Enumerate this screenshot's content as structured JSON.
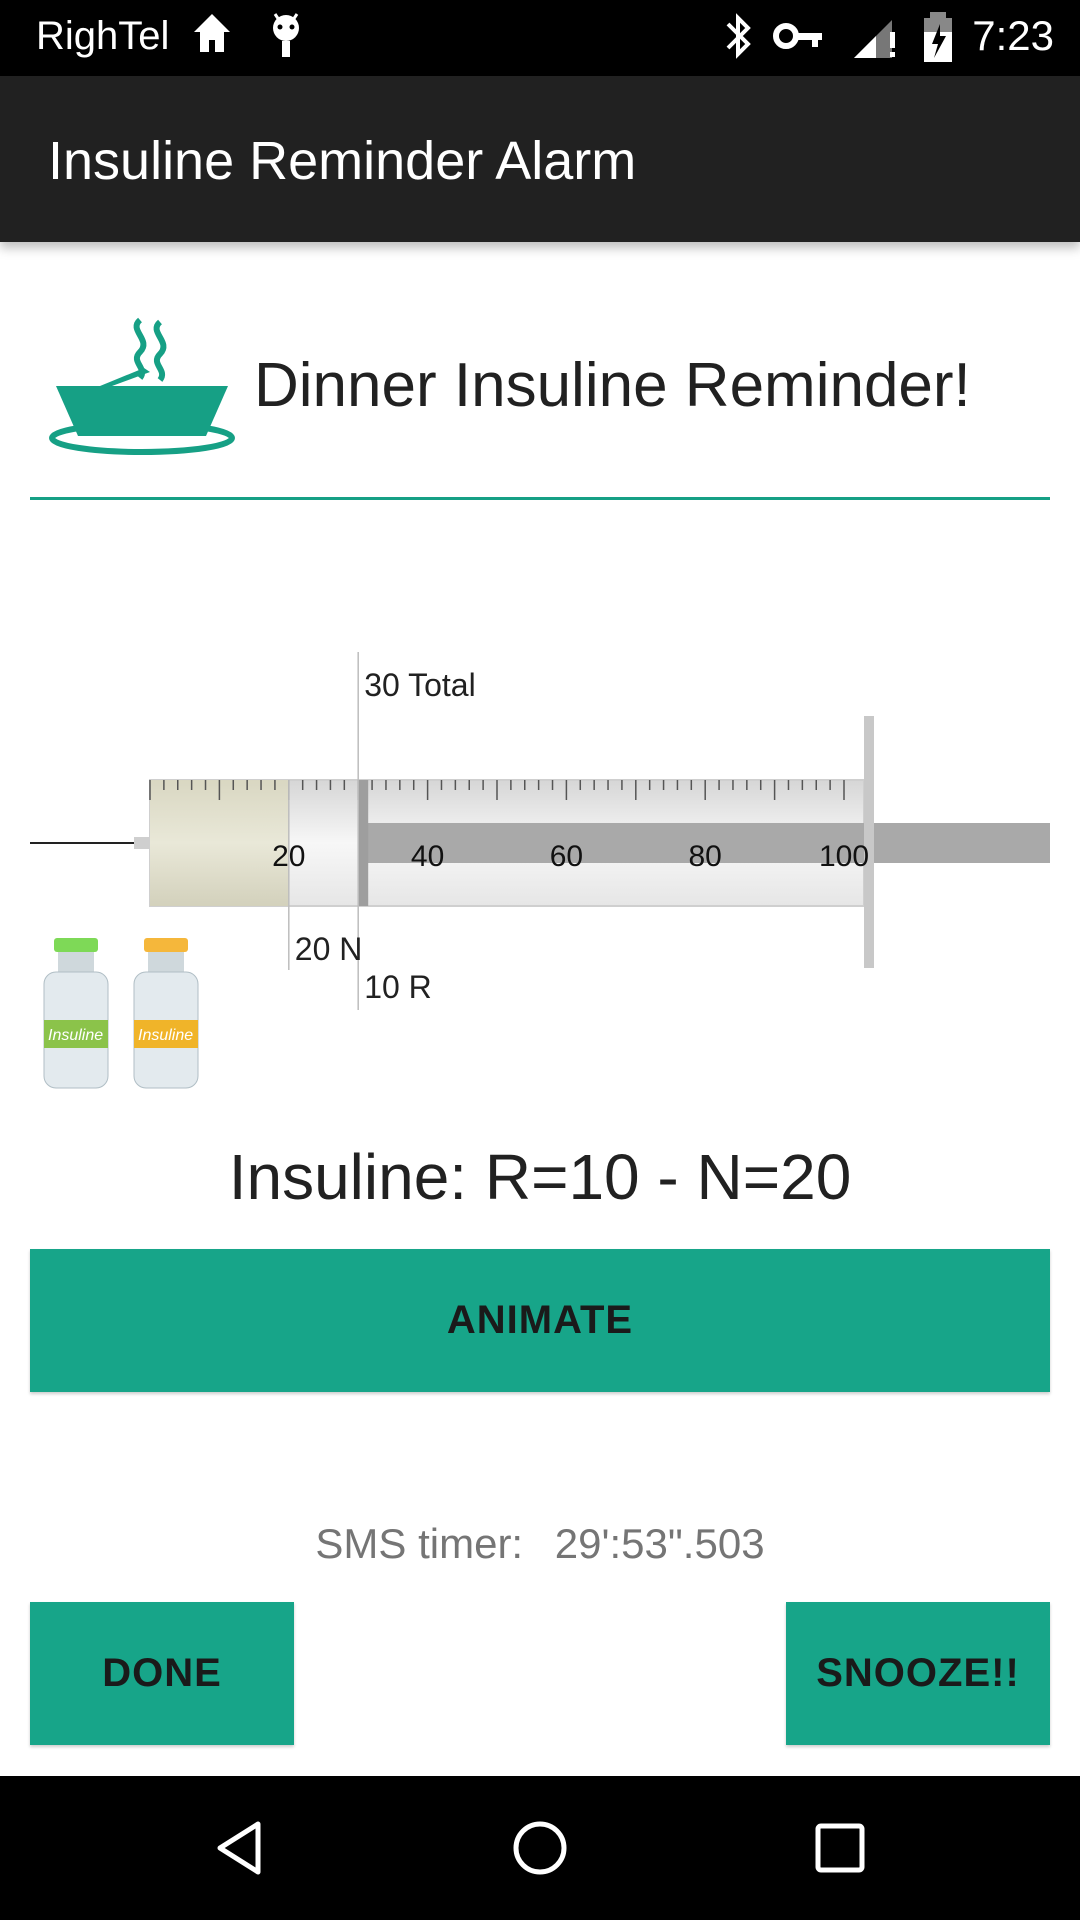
{
  "status_bar": {
    "carrier": "RighTel",
    "time": "7:23",
    "icons": [
      "home-icon",
      "android-icon",
      "bluetooth-icon",
      "vpn-key-icon",
      "signal-icon",
      "battery-icon"
    ]
  },
  "app_bar": {
    "title": "Insuline Reminder Alarm"
  },
  "header": {
    "title": "Dinner Insuline Reminder!",
    "icon": "dinner-bowl-icon"
  },
  "syringe": {
    "scale_labels": [
      "20",
      "40",
      "60",
      "80",
      "100"
    ],
    "total_label": "30 Total",
    "n_label": "20 N",
    "r_label": "10 R",
    "scale_max": 100,
    "n_units": 20,
    "r_units": 10,
    "total_units": 30
  },
  "summary": {
    "text": "Insuline: R=10 - N=20"
  },
  "buttons": {
    "animate": "ANIMATE",
    "done": "DONE",
    "snooze": "SNOOZE!!"
  },
  "sms": {
    "label": "SMS timer:",
    "value": "29':53\".503"
  },
  "colors": {
    "accent": "#16a085",
    "button": "#17a589"
  }
}
